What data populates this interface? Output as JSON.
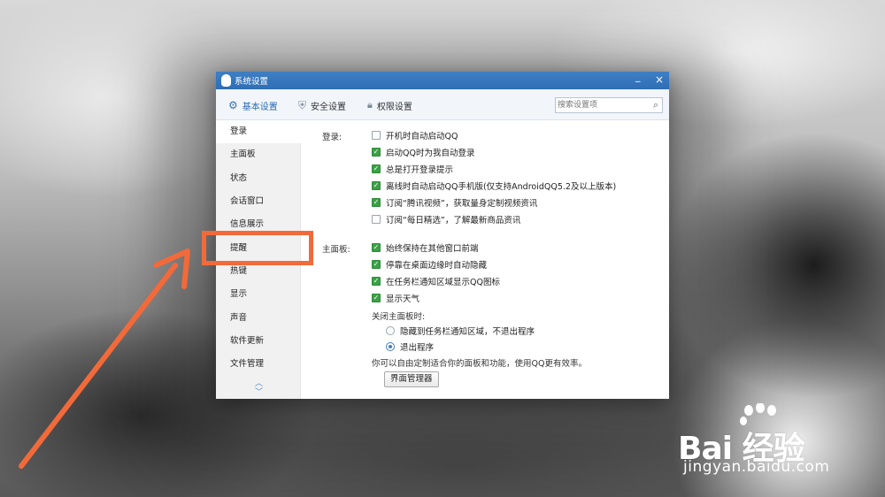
{
  "window": {
    "title": "系统设置",
    "minimize_glyph": "_",
    "close_glyph": "×"
  },
  "tabs": [
    {
      "label": "基本设置",
      "icon": "gear-icon"
    },
    {
      "label": "安全设置",
      "icon": "shield-icon"
    },
    {
      "label": "权限设置",
      "icon": "lock-icon"
    }
  ],
  "search": {
    "placeholder": "搜索设置项",
    "icon": "search-icon"
  },
  "sidebar": {
    "items": [
      {
        "label": "登录"
      },
      {
        "label": "主面板"
      },
      {
        "label": "状态"
      },
      {
        "label": "会话窗口"
      },
      {
        "label": "信息展示"
      },
      {
        "label": "提醒"
      },
      {
        "label": "热键"
      },
      {
        "label": "显示"
      },
      {
        "label": "声音"
      },
      {
        "label": "软件更新"
      },
      {
        "label": "文件管理"
      }
    ],
    "active_index": 0
  },
  "login_section": {
    "label": "登录:",
    "options": [
      {
        "label": "开机时自动启动QQ",
        "checked": false
      },
      {
        "label": "启动QQ时为我自动登录",
        "checked": true
      },
      {
        "label": "总是打开登录提示",
        "checked": true
      },
      {
        "label": "离线时自动启动QQ手机版(仅支持AndroidQQ5.2及以上版本)",
        "checked": true
      },
      {
        "label": "订阅“腾讯视频”，获取量身定制视频资讯",
        "checked": true
      },
      {
        "label": "订阅“每日精选”，了解最新商品资讯",
        "checked": false
      }
    ]
  },
  "panel_section": {
    "label": "主面板:",
    "options": [
      {
        "label": "始终保持在其他窗口前端",
        "checked": true
      },
      {
        "label": "停靠在桌面边缘时自动隐藏",
        "checked": true
      },
      {
        "label": "在任务栏通知区域显示QQ图标",
        "checked": true
      },
      {
        "label": "显示天气",
        "checked": true
      }
    ],
    "close_label": "关闭主面板时:",
    "close_options": [
      {
        "label": "隐藏到任务栏通知区域，不退出程序",
        "selected": false
      },
      {
        "label": "退出程序",
        "selected": true
      }
    ],
    "hint": "你可以自由定制适合你的面板和功能，使用QQ更有效率。",
    "manager_button": "界面管理器"
  },
  "annotation": {
    "color": "#f26a3a",
    "highlighted_item": "提醒"
  },
  "watermark": {
    "brand": "Bai  经验",
    "url": "jingyan.baidu.com"
  }
}
